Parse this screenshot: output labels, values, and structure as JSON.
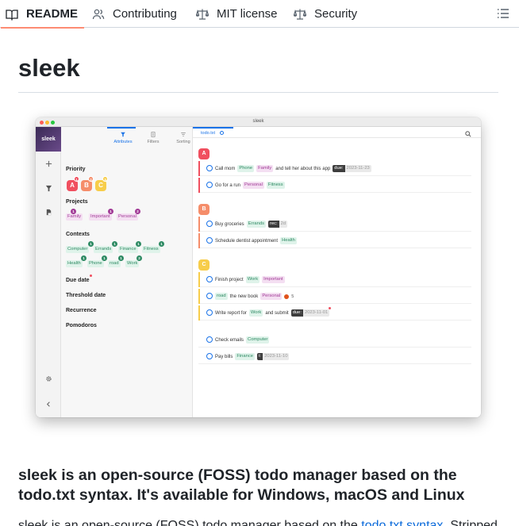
{
  "tabs": [
    {
      "label": "README",
      "icon": "book-icon"
    },
    {
      "label": "Contributing",
      "icon": "people-icon"
    },
    {
      "label": "MIT license",
      "icon": "law-icon"
    },
    {
      "label": "Security",
      "icon": "law-icon"
    }
  ],
  "readme": {
    "title": "sleek",
    "heading": "sleek is an open-source (FOSS) todo manager based on the todo.txt syntax. It's available for Windows, macOS and Linux",
    "para_start": "sleek is an open-source (FOSS) todo manager based on the ",
    "para_link": "todo.txt syntax",
    "para_end": ". Stripped"
  },
  "app": {
    "window_title": "sleek",
    "logo": "sleek",
    "drawer_tabs": [
      "Attributes",
      "Filters",
      "Sorting"
    ],
    "sections": {
      "priority": "Priority",
      "projects": "Projects",
      "contexts": "Contexts",
      "due": "Due date",
      "threshold": "Threshold date",
      "recurrence": "Recurrence",
      "pomodoros": "Pomodoros"
    },
    "priorities": [
      {
        "label": "A",
        "count": "1"
      },
      {
        "label": "B",
        "count": "2"
      },
      {
        "label": "C",
        "count": "3"
      }
    ],
    "projects": [
      {
        "label": "Family",
        "count": "1"
      },
      {
        "label": "Important",
        "count": "1"
      },
      {
        "label": "Personal",
        "count": "2"
      }
    ],
    "contexts": [
      {
        "label": "Computer",
        "count": "1"
      },
      {
        "label": "Errands",
        "count": "1"
      },
      {
        "label": "Finance",
        "count": "1"
      },
      {
        "label": "Fitness",
        "count": "1"
      },
      {
        "label": "Health",
        "count": "1"
      },
      {
        "label": "Phone",
        "count": "1"
      },
      {
        "label": "road",
        "count": "1"
      },
      {
        "label": "Work",
        "count": "2"
      }
    ],
    "file_tab": "todo.txt",
    "groups": [
      "A",
      "B",
      "C"
    ],
    "tasks": {
      "t1": {
        "text1": "Call mom",
        "ctx": "Phone",
        "prj": "Family",
        "text2": "and tell her about this app",
        "due_label": "due:",
        "due": "2023-11-23"
      },
      "t2": {
        "text1": "Go for a run",
        "prj": "Personal",
        "ctx": "Fitness"
      },
      "t3": {
        "text1": "Buy groceries",
        "ctx": "Errands",
        "rec_label": "rec:",
        "rec": "2d"
      },
      "t4": {
        "text1": "Schedule dentist appointment",
        "ctx": "Health"
      },
      "t5": {
        "text1": "Finish project",
        "ctx": "Work",
        "prj": "Important"
      },
      "t6": {
        "ctx": "road",
        "text1": "the new book",
        "prj": "Personal",
        "pomo": "5"
      },
      "t7": {
        "text1": "Write report for",
        "ctx": "Work",
        "text2": "and submit",
        "due_label": "due:",
        "due": "2023-11-01"
      },
      "t8": {
        "text1": "Check emails",
        "ctx": "Computer"
      },
      "t9": {
        "text1": "Pay bills",
        "ctx": "Finance",
        "t_label": "t:",
        "t": "2023-11-10"
      }
    },
    "colors": {
      "priority_a": "#f04f5f",
      "priority_b": "#f58d6a",
      "priority_c": "#f7cd4a",
      "accent": "#1a73e8",
      "context_badge": "#2e8a63",
      "project_badge": "#a13a96"
    }
  }
}
